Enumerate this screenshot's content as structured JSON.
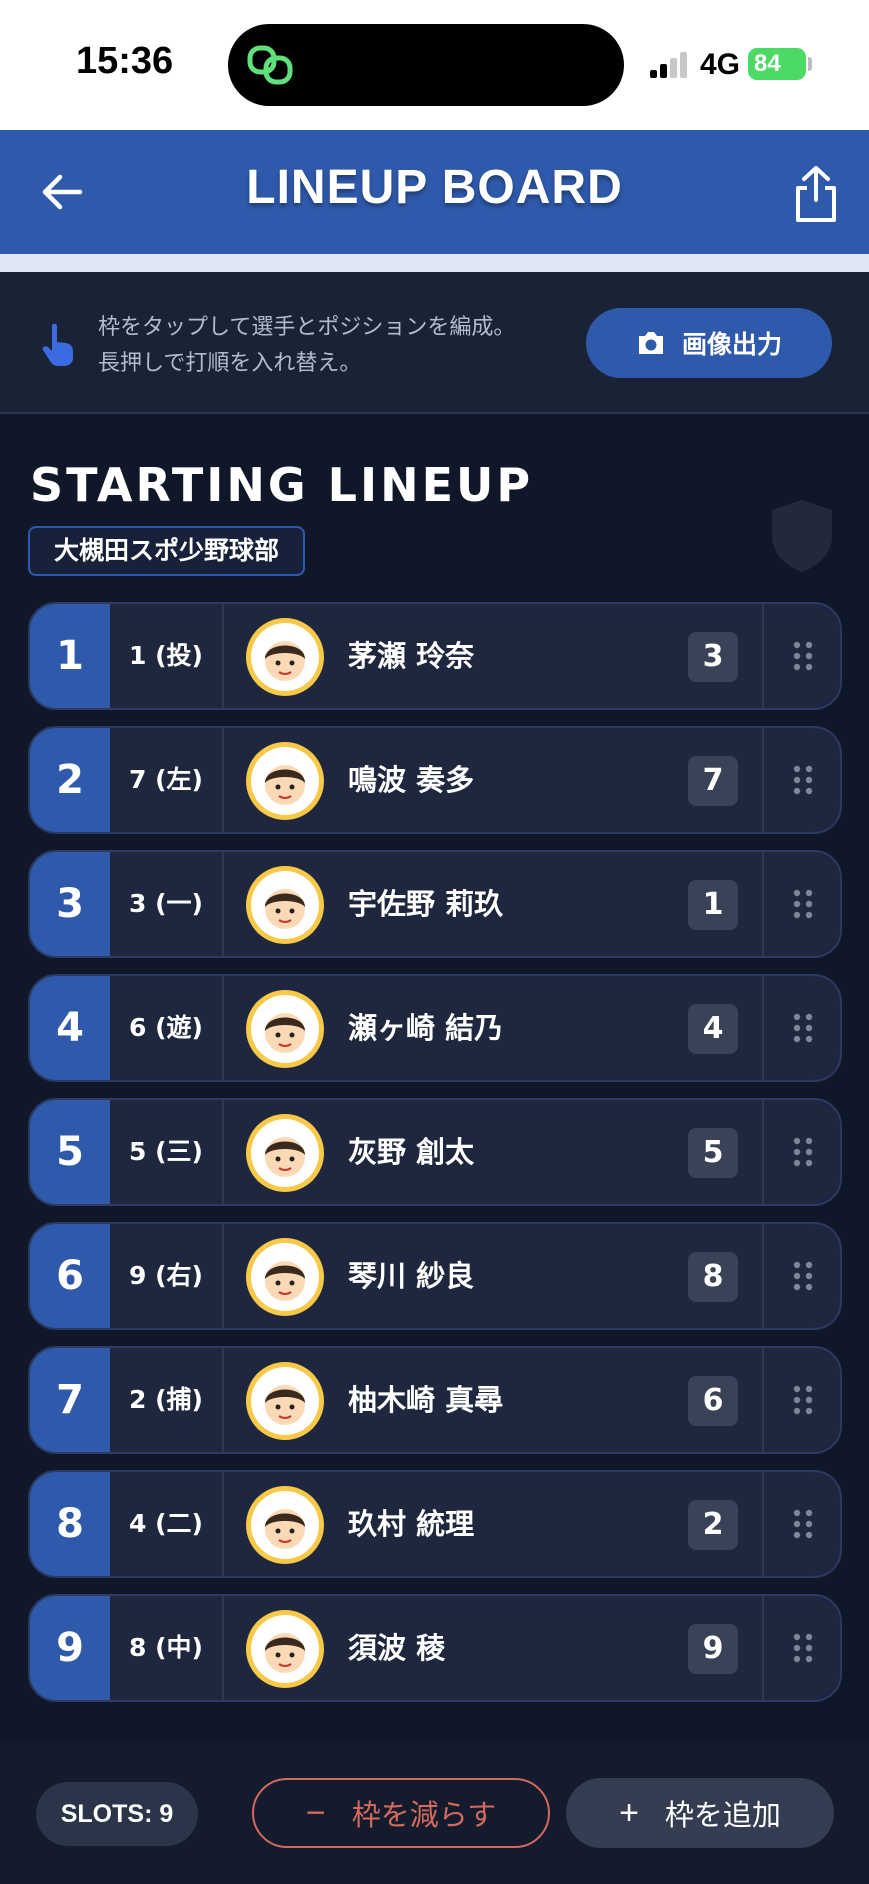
{
  "status_bar": {
    "time": "15:36",
    "network": "4G",
    "battery": "84"
  },
  "header": {
    "title": "LINEUP BOARD"
  },
  "info": {
    "line1": "枠をタップして選手とポジションを編成。",
    "line2": "長押しで打順を入れ替え。",
    "export_label": "画像出力"
  },
  "lineup": {
    "title": "STARTING LINEUP",
    "team": "大槻田スポ少野球部",
    "rows": [
      {
        "order": "1",
        "position": "1 (投)",
        "name": "茅瀬 玲奈",
        "number": "3"
      },
      {
        "order": "2",
        "position": "7 (左)",
        "name": "鳴波 奏多",
        "number": "7"
      },
      {
        "order": "3",
        "position": "3 (一)",
        "name": "宇佐野 莉玖",
        "number": "1"
      },
      {
        "order": "4",
        "position": "6 (遊)",
        "name": "瀬ヶ崎 結乃",
        "number": "4"
      },
      {
        "order": "5",
        "position": "5 (三)",
        "name": "灰野 創太",
        "number": "5"
      },
      {
        "order": "6",
        "position": "9 (右)",
        "name": "琴川 紗良",
        "number": "8"
      },
      {
        "order": "7",
        "position": "2 (捕)",
        "name": "柚木崎 真尋",
        "number": "6"
      },
      {
        "order": "8",
        "position": "4 (二)",
        "name": "玖村 統理",
        "number": "2"
      },
      {
        "order": "9",
        "position": "8 (中)",
        "name": "須波 稜",
        "number": "9"
      }
    ]
  },
  "footer": {
    "slots_label": "SLOTS: 9",
    "remove_label": "枠を減らす",
    "remove_sign": "−",
    "add_label": "枠を追加",
    "add_sign": "+"
  },
  "colors": {
    "accent": "#2f5aac",
    "background": "#0f1628",
    "row": "#1e273d",
    "danger": "#d26a5d",
    "avatar_ring": "#f7c948"
  },
  "icons": {
    "back": "arrow-left-icon",
    "share": "share-icon",
    "hint": "hand-pointer-icon",
    "camera": "camera-icon",
    "shield": "shield-icon",
    "drag": "drag-handle-icon",
    "avatar": "avatar-icon"
  }
}
